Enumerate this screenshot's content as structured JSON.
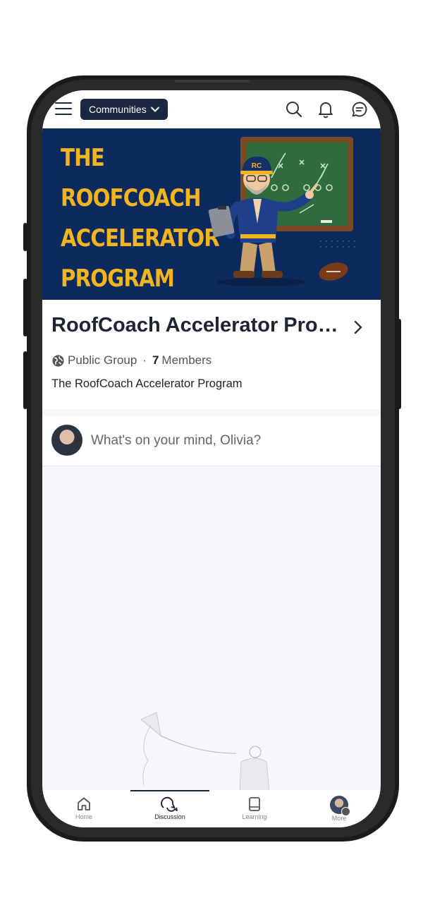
{
  "topbar": {
    "communities_label": "Communities",
    "icons": [
      "menu-icon",
      "chevron-down-icon",
      "search-icon",
      "bell-icon",
      "chat-icon"
    ]
  },
  "banner": {
    "title_lines": [
      "THE ROOFCOACH",
      "ACCELERATOR",
      "PROGRAM"
    ],
    "cap_text": "RC",
    "background": "#0d2a5e",
    "title_color": "#f2b51e"
  },
  "group": {
    "name": "RoofCoach Accelerator Pro…",
    "privacy": "Public Group",
    "separator": "·",
    "members_count": "7",
    "members_label": "Members",
    "description": "The RoofCoach Accelerator Program"
  },
  "composer": {
    "placeholder": "What's on your mind, Olivia?"
  },
  "tabs": [
    {
      "label": "Home",
      "icon": "home-icon"
    },
    {
      "label": "Discussion",
      "icon": "discussion-icon"
    },
    {
      "label": "Learning",
      "icon": "book-icon"
    },
    {
      "label": "More",
      "icon": "avatar"
    }
  ],
  "active_tab": "Discussion"
}
